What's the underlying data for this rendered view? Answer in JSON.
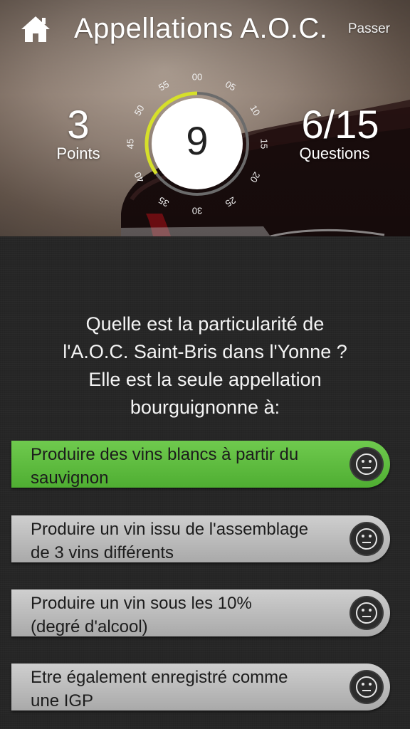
{
  "header": {
    "title": "Appellations A.O.C.",
    "skip_label": "Passer",
    "home_icon": "home-icon"
  },
  "stats": {
    "points_value": "3",
    "points_label": "Points",
    "questions_value": "6/15",
    "questions_label": "Questions"
  },
  "timer": {
    "value": "9",
    "ticks": [
      "00",
      "05",
      "10",
      "15",
      "20",
      "25",
      "30",
      "35",
      "40",
      "45",
      "50",
      "55"
    ],
    "progress_fraction": 0.35,
    "progress_color": "#d6e02a"
  },
  "question": {
    "line1": "Quelle est la particularité de",
    "line2": "l'A.O.C. Saint-Bris dans l'Yonne ?",
    "line3": "Elle est la seule appellation",
    "line4": "bourguignonne à:"
  },
  "answers": [
    {
      "line1": "Produire des vins blancs à partir du",
      "line2": "sauvignon",
      "state": "correct",
      "icon": "neutral-face-icon"
    },
    {
      "line1": "Produire un vin issu de l'assemblage",
      "line2": "de 3 vins différents",
      "state": "neutral",
      "icon": "neutral-face-icon"
    },
    {
      "line1": "Produire un vin sous les 10%",
      "line2": "(degré d'alcool)",
      "state": "neutral",
      "icon": "neutral-face-icon"
    },
    {
      "line1": "Etre également enregistré comme",
      "line2": "une IGP",
      "state": "neutral",
      "icon": "neutral-face-icon"
    }
  ],
  "colors": {
    "correct_answer": "#5bb83c",
    "neutral_answer": "#bcbcbc",
    "background": "#262626"
  }
}
